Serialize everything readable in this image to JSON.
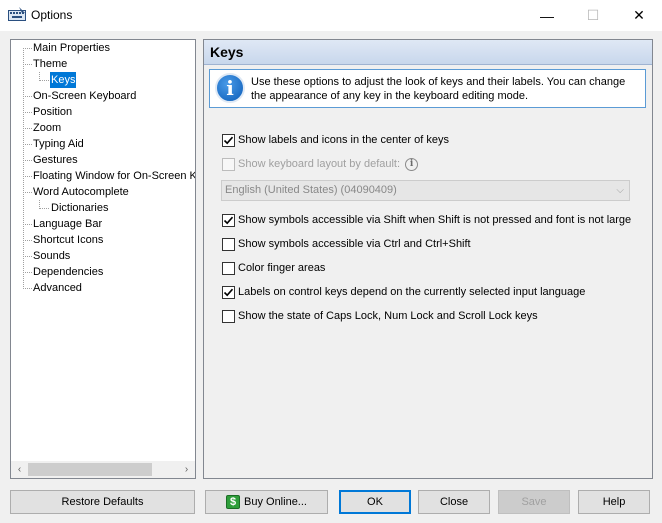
{
  "window": {
    "title": "Options",
    "app_icon": "keyboard-icon",
    "controls": {
      "minimize": "—",
      "maximize": "☐",
      "close": "✕"
    }
  },
  "tree": {
    "items": [
      {
        "label": "Main Properties",
        "level": 0
      },
      {
        "label": "Theme",
        "level": 0
      },
      {
        "label": "Keys",
        "level": 1,
        "selected": true
      },
      {
        "label": "On-Screen Keyboard",
        "level": 0
      },
      {
        "label": "Position",
        "level": 0
      },
      {
        "label": "Zoom",
        "level": 0
      },
      {
        "label": "Typing Aid",
        "level": 0
      },
      {
        "label": "Gestures",
        "level": 0
      },
      {
        "label": "Floating Window for On-Screen Keyboard",
        "level": 0
      },
      {
        "label": "Word Autocomplete",
        "level": 0
      },
      {
        "label": "Dictionaries",
        "level": 1
      },
      {
        "label": "Language Bar",
        "level": 0
      },
      {
        "label": "Shortcut Icons",
        "level": 0
      },
      {
        "label": "Sounds",
        "level": 0
      },
      {
        "label": "Dependencies",
        "level": 0
      },
      {
        "label": "Advanced",
        "level": 0
      }
    ],
    "scroll_left": "‹",
    "scroll_right": "›"
  },
  "panel": {
    "title": "Keys",
    "info_icon": "info-icon",
    "info_glyph": "i",
    "info_text": "Use these options to adjust the look of keys and their labels. You can change the appearance of any key in the keyboard editing mode.",
    "options": [
      {
        "label": "Show labels and icons in the center of keys",
        "checked": true,
        "disabled": false
      },
      {
        "label": "Show keyboard layout by default:",
        "checked": false,
        "disabled": true,
        "help": "i"
      },
      {
        "label": "Show symbols accessible via Shift when Shift is not pressed and font is not large",
        "checked": true,
        "disabled": false
      },
      {
        "label": "Show symbols accessible via Ctrl and Ctrl+Shift",
        "checked": false,
        "disabled": false
      },
      {
        "label": "Color finger areas",
        "checked": false,
        "disabled": false
      },
      {
        "label": "Labels on control keys depend on the currently selected input language",
        "checked": true,
        "disabled": false
      },
      {
        "label": "Show the state of Caps Lock, Num Lock and Scroll Lock keys",
        "checked": false,
        "disabled": false
      }
    ],
    "layout_select": {
      "value": "English (United States) (04090409)",
      "disabled": true,
      "chevron": "⌵"
    }
  },
  "buttons": {
    "restore_defaults": "Restore Defaults",
    "buy_online": "Buy Online...",
    "buy_icon_glyph": "$",
    "ok": "OK",
    "close": "Close",
    "save": "Save",
    "help": "Help"
  },
  "colors": {
    "accent": "#0078d7",
    "header_gradient_top": "#dfe8f5",
    "header_gradient_bottom": "#c8d7ec"
  }
}
